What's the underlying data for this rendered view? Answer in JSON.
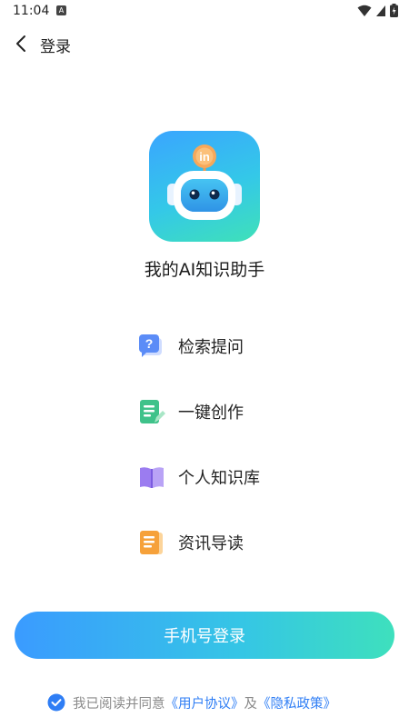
{
  "status_bar": {
    "time": "11:04",
    "notification_icon": "A"
  },
  "nav": {
    "title": "登录"
  },
  "app": {
    "name": "我的AI知识助手",
    "badge": "in"
  },
  "features": [
    {
      "label": "检索提问",
      "icon": "question-bubble-icon",
      "color": "#5b8cf7"
    },
    {
      "label": "一键创作",
      "icon": "edit-document-icon",
      "color": "#3fc28a"
    },
    {
      "label": "个人知识库",
      "icon": "open-book-icon",
      "color": "#9b7cf0"
    },
    {
      "label": "资讯导读",
      "icon": "news-document-icon",
      "color": "#f6a13a"
    }
  ],
  "login": {
    "button_label": "手机号登录"
  },
  "agreement": {
    "checked": true,
    "prefix": "我已阅读并同意",
    "user_agreement": "《用户协议》",
    "conjunction": "及",
    "privacy_policy": "《隐私政策》"
  },
  "colors": {
    "accent": "#2f7ef5",
    "gradient_start": "#3a9bff",
    "gradient_end": "#3ee0bd"
  }
}
